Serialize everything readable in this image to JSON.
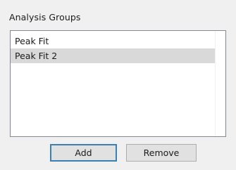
{
  "group": {
    "title": "Analysis Groups"
  },
  "list": {
    "items": [
      {
        "label": "Peak Fit",
        "selected": false
      },
      {
        "label": "Peak Fit 2",
        "selected": true
      }
    ]
  },
  "buttons": {
    "add_label": "Add",
    "remove_label": "Remove"
  },
  "colors": {
    "background": "#f0f0f0",
    "list_background": "#ffffff",
    "selection": "#d9d9d9",
    "default_button_border": "#3c7fb1"
  }
}
